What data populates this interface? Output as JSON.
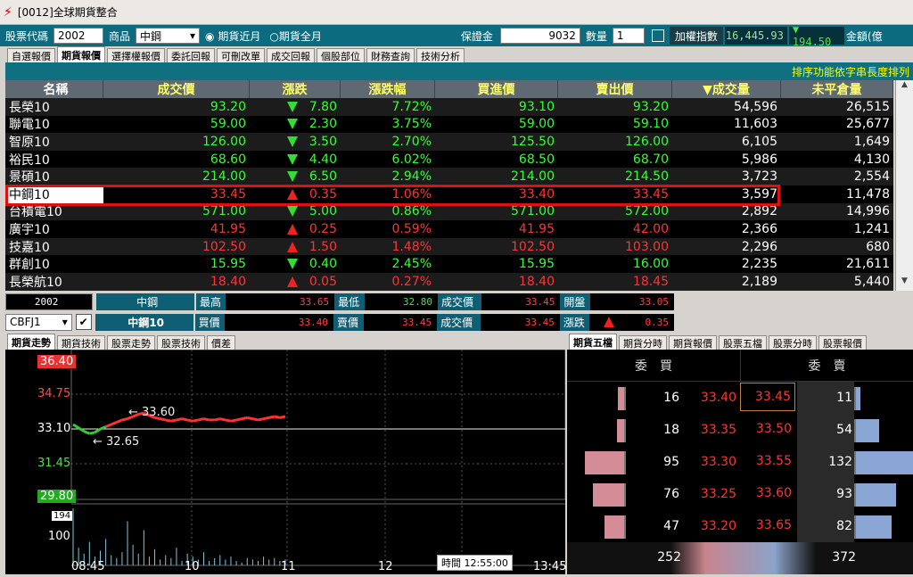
{
  "window": {
    "title": "[0012]全球期貨整合"
  },
  "controls": {
    "stock_code_label": "股票代碼",
    "stock_code": "2002",
    "product_label": "商品",
    "product": "中鋼",
    "radio_near": "期貨近月",
    "radio_all": "期貨全月",
    "margin_label": "保證金",
    "margin_value": "9032",
    "qty_label": "數量",
    "qty_value": "1",
    "index_label": "加權指數",
    "index_value": "16,445.93",
    "index_change": "▼ 194.50",
    "amount_label": "金額(億"
  },
  "tabs": [
    "自選報價",
    "期貨報價",
    "選擇權報價",
    "委託回報",
    "可刪改單",
    "成交回報",
    "個股部位",
    "財務查詢",
    "技術分析"
  ],
  "active_tab": 1,
  "sort_hint": "排序功能依字串長度排列",
  "table": {
    "headers": [
      "名稱",
      "成交價",
      "漲跌",
      "漲跌幅",
      "買進價",
      "賣出價",
      "▼成交量",
      "未平倉量"
    ],
    "rows": [
      {
        "name": "長榮10",
        "price": "93.20",
        "dir": "dn",
        "chg": "7.80",
        "pct": "7.72%",
        "bid": "93.10",
        "ask": "93.20",
        "vol": "54,596",
        "oi": "26,515"
      },
      {
        "name": "聯電10",
        "price": "59.00",
        "dir": "dn",
        "chg": "2.30",
        "pct": "3.75%",
        "bid": "59.00",
        "ask": "59.10",
        "vol": "11,603",
        "oi": "25,677"
      },
      {
        "name": "智原10",
        "price": "126.00",
        "dir": "dn",
        "chg": "3.50",
        "pct": "2.70%",
        "bid": "125.50",
        "ask": "126.00",
        "vol": "6,105",
        "oi": "1,649"
      },
      {
        "name": "裕民10",
        "price": "68.60",
        "dir": "dn",
        "chg": "4.40",
        "pct": "6.02%",
        "bid": "68.50",
        "ask": "68.70",
        "vol": "5,986",
        "oi": "4,130"
      },
      {
        "name": "景碩10",
        "price": "214.00",
        "dir": "dn",
        "chg": "6.50",
        "pct": "2.94%",
        "bid": "214.00",
        "ask": "214.50",
        "vol": "3,723",
        "oi": "2,554"
      },
      {
        "name": "中鋼10",
        "price": "33.45",
        "dir": "up",
        "chg": "0.35",
        "pct": "1.06%",
        "bid": "33.40",
        "ask": "33.45",
        "vol": "3,597",
        "oi": "11,478"
      },
      {
        "name": "台積電10",
        "price": "571.00",
        "dir": "dn",
        "chg": "5.00",
        "pct": "0.86%",
        "bid": "571.00",
        "ask": "572.00",
        "vol": "2,892",
        "oi": "14,996"
      },
      {
        "name": "廣宇10",
        "price": "41.95",
        "dir": "up",
        "chg": "0.25",
        "pct": "0.59%",
        "bid": "41.95",
        "ask": "42.00",
        "vol": "2,366",
        "oi": "1,241"
      },
      {
        "name": "技嘉10",
        "price": "102.50",
        "dir": "up",
        "chg": "1.50",
        "pct": "1.48%",
        "bid": "102.50",
        "ask": "103.00",
        "vol": "2,296",
        "oi": "680"
      },
      {
        "name": "群創10",
        "price": "15.95",
        "dir": "dn",
        "chg": "0.40",
        "pct": "2.45%",
        "bid": "15.95",
        "ask": "16.00",
        "vol": "2,235",
        "oi": "21,611"
      },
      {
        "name": "長榮航10",
        "price": "18.40",
        "dir": "up",
        "chg": "0.05",
        "pct": "0.27%",
        "bid": "18.40",
        "ask": "18.45",
        "vol": "2,189",
        "oi": "5,440"
      }
    ]
  },
  "info": {
    "code": "2002",
    "name": "中鋼",
    "high_label": "最高",
    "high": "33.65",
    "low_label": "最低",
    "low": "32.80",
    "last_label": "成交價",
    "last": "33.45",
    "open_label": "開盤",
    "open": "33.05",
    "contract": "CBFJ1",
    "contract_name": "中鋼10",
    "bid_label": "買價",
    "bid": "33.40",
    "ask_label": "賣價",
    "ask": "33.45",
    "last2_label": "成交價",
    "last2": "33.45",
    "chg_label": "漲跌",
    "chg": "0.35"
  },
  "lower_tabs_left": [
    "期貨走勢",
    "期貨技術",
    "股票走勢",
    "股票技術",
    "價差"
  ],
  "lower_tabs_right": [
    "期貨五檔",
    "期貨分時",
    "期貨報價",
    "股票五檔",
    "股票分時",
    "股票報價"
  ],
  "chart": {
    "y_labels": [
      "36.40",
      "34.75",
      "33.10",
      "31.45",
      "29.80"
    ],
    "vol_labels": [
      "194",
      "100"
    ],
    "x_labels": [
      "08:45",
      "10",
      "11",
      "12",
      "13:45"
    ],
    "high_note": "33.60",
    "low_note": "32.65",
    "time_label": "時間",
    "time_value": "12:55:00"
  },
  "chart_data": {
    "type": "line",
    "title": "",
    "y_ticks": [
      36.4,
      34.75,
      33.1,
      31.45,
      29.8
    ],
    "ylim": [
      29.8,
      36.4
    ],
    "ref_price": 33.1,
    "annot_high": 33.6,
    "annot_low": 32.65,
    "x_ticks": [
      "08:45",
      "10",
      "11",
      "12",
      "13:45"
    ],
    "volume_max": 194
  },
  "orderbook": {
    "bid_header": "委　買",
    "ask_header": "委　賣",
    "levels": [
      {
        "bq": "16",
        "bp": "33.40",
        "ap": "33.45",
        "aq": "11",
        "bfrac": 0.17,
        "afrac": 0.08
      },
      {
        "bq": "18",
        "bp": "33.35",
        "ap": "33.50",
        "aq": "54",
        "bfrac": 0.19,
        "afrac": 0.41
      },
      {
        "bq": "95",
        "bp": "33.30",
        "ap": "33.55",
        "aq": "132",
        "bfrac": 1.0,
        "afrac": 1.0
      },
      {
        "bq": "76",
        "bp": "33.25",
        "ap": "33.60",
        "aq": "93",
        "bfrac": 0.8,
        "afrac": 0.7
      },
      {
        "bq": "47",
        "bp": "33.20",
        "ap": "33.65",
        "aq": "82",
        "bfrac": 0.49,
        "afrac": 0.62
      }
    ],
    "bid_total": "252",
    "ask_total": "372"
  }
}
